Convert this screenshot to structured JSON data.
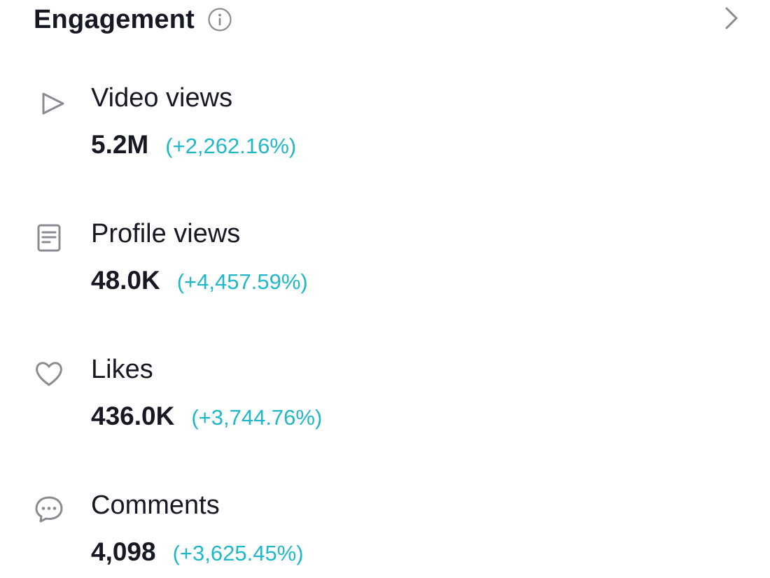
{
  "header": {
    "title": "Engagement",
    "info_icon": "info-circle-icon",
    "more_icon": "chevron-right-icon"
  },
  "colors": {
    "text": "#161823",
    "icon": "#8a8b91",
    "positive_change": "#20b8c8"
  },
  "metrics": [
    {
      "icon": "play-icon",
      "label": "Video views",
      "value": "5.2M",
      "change": "(+2,262.16%)"
    },
    {
      "icon": "document-icon",
      "label": "Profile views",
      "value": "48.0K",
      "change": "(+4,457.59%)"
    },
    {
      "icon": "heart-icon",
      "label": "Likes",
      "value": "436.0K",
      "change": "(+3,744.76%)"
    },
    {
      "icon": "comment-icon",
      "label": "Comments",
      "value": "4,098",
      "change": "(+3,625.45%)"
    }
  ]
}
